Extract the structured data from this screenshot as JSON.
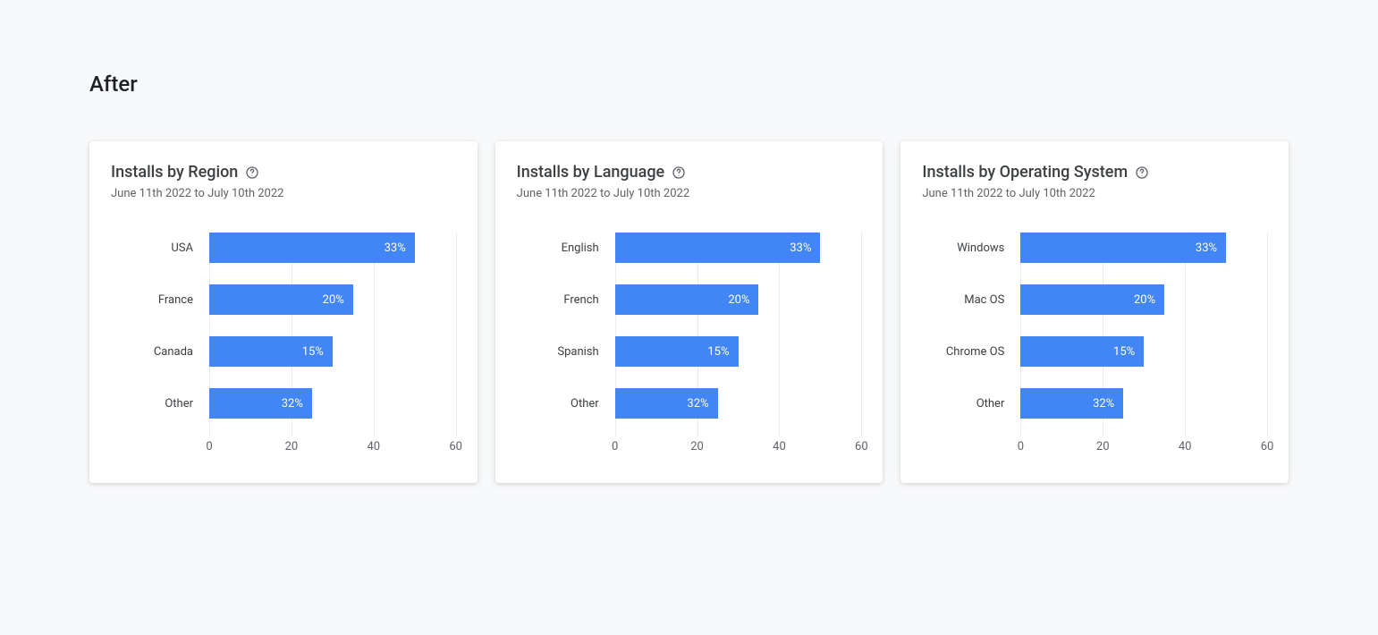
{
  "page_title": "After",
  "date_range": "June 11th 2022 to July 10th 2022",
  "axis_max": 60,
  "ticks": [
    0,
    20,
    40,
    60
  ],
  "cards": [
    {
      "title": "Installs by Region",
      "rows": [
        {
          "label": "USA",
          "value": 33,
          "display": "33%",
          "draw": 50
        },
        {
          "label": "France",
          "value": 20,
          "display": "20%",
          "draw": 35
        },
        {
          "label": "Canada",
          "value": 15,
          "display": "15%",
          "draw": 30
        },
        {
          "label": "Other",
          "value": 32,
          "display": "32%",
          "draw": 25
        }
      ]
    },
    {
      "title": "Installs by Language",
      "rows": [
        {
          "label": "English",
          "value": 33,
          "display": "33%",
          "draw": 50
        },
        {
          "label": "French",
          "value": 20,
          "display": "20%",
          "draw": 35
        },
        {
          "label": "Spanish",
          "value": 15,
          "display": "15%",
          "draw": 30
        },
        {
          "label": "Other",
          "value": 32,
          "display": "32%",
          "draw": 25
        }
      ]
    },
    {
      "title": "Installs by Operating System",
      "rows": [
        {
          "label": "Windows",
          "value": 33,
          "display": "33%",
          "draw": 50
        },
        {
          "label": "Mac OS",
          "value": 20,
          "display": "20%",
          "draw": 35
        },
        {
          "label": "Chrome OS",
          "value": 15,
          "display": "15%",
          "draw": 30
        },
        {
          "label": "Other",
          "value": 32,
          "display": "32%",
          "draw": 25
        }
      ]
    }
  ],
  "chart_data": [
    {
      "type": "bar",
      "orientation": "horizontal",
      "title": "Installs by Region",
      "subtitle": "June 11th 2022 to July 10th 2022",
      "categories": [
        "USA",
        "France",
        "Canada",
        "Other"
      ],
      "values": [
        33,
        20,
        15,
        32
      ],
      "value_suffix": "%",
      "xlim": [
        0,
        60
      ],
      "xticks": [
        0,
        20,
        40,
        60
      ]
    },
    {
      "type": "bar",
      "orientation": "horizontal",
      "title": "Installs by Language",
      "subtitle": "June 11th 2022 to July 10th 2022",
      "categories": [
        "English",
        "French",
        "Spanish",
        "Other"
      ],
      "values": [
        33,
        20,
        15,
        32
      ],
      "value_suffix": "%",
      "xlim": [
        0,
        60
      ],
      "xticks": [
        0,
        20,
        40,
        60
      ]
    },
    {
      "type": "bar",
      "orientation": "horizontal",
      "title": "Installs by Operating System",
      "subtitle": "June 11th 2022 to July 10th 2022",
      "categories": [
        "Windows",
        "Mac OS",
        "Chrome OS",
        "Other"
      ],
      "values": [
        33,
        20,
        15,
        32
      ],
      "value_suffix": "%",
      "xlim": [
        0,
        60
      ],
      "xticks": [
        0,
        20,
        40,
        60
      ]
    }
  ]
}
